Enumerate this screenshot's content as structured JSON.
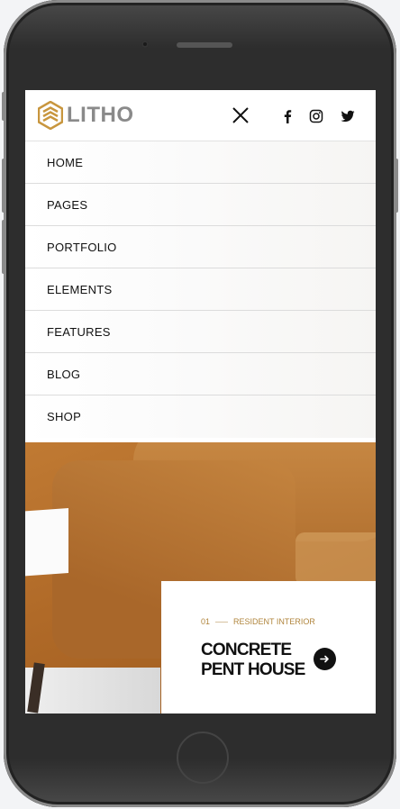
{
  "header": {
    "logo_text": "LITHO"
  },
  "menu": {
    "items": [
      {
        "label": "HOME"
      },
      {
        "label": "PAGES"
      },
      {
        "label": "PORTFOLIO"
      },
      {
        "label": "ELEMENTS"
      },
      {
        "label": "FEATURES"
      },
      {
        "label": "BLOG"
      },
      {
        "label": "SHOP"
      }
    ]
  },
  "hero": {
    "number": "01",
    "category": "RESIDENT INTERIOR",
    "title_line1": "CONCRETE",
    "title_line2": "PENT HOUSE"
  },
  "colors": {
    "accent": "#b0853c",
    "sofa": "#b06a28",
    "text": "#111111"
  },
  "icons": [
    "litho-logo-icon",
    "close-icon",
    "facebook-icon",
    "instagram-icon",
    "twitter-icon",
    "arrow-right-icon"
  ]
}
